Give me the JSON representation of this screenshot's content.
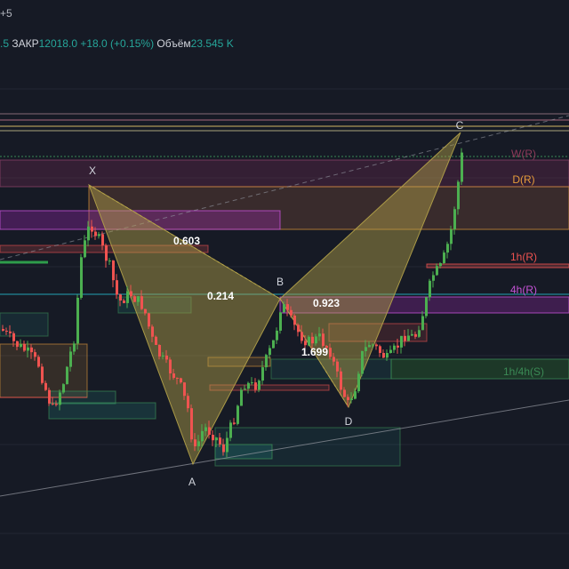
{
  "header": {
    "symbol_fragment": "+5",
    "quote": {
      "prev_fragment": ".5",
      "close_label": "ЗАКР",
      "close_value": "12018.0",
      "change": "+18.0 (+0.15%)",
      "volume_label": "Объём",
      "volume_value": "23.545 K"
    }
  },
  "pattern": {
    "points": [
      {
        "label": "X",
        "color": "#d1d4dc"
      },
      {
        "label": "A",
        "color": "#d1d4dc"
      },
      {
        "label": "B",
        "color": "#d1d4dc"
      },
      {
        "label": "C",
        "color": "#d1d4dc"
      },
      {
        "label": "D",
        "color": "#d1d4dc"
      }
    ],
    "ratios": [
      {
        "value": "0.603",
        "color": "#ffffff"
      },
      {
        "value": "0.214",
        "color": "#ffffff"
      },
      {
        "value": "0.923",
        "color": "#ffffff"
      },
      {
        "value": "1.699",
        "color": "#ffffff"
      }
    ],
    "fill_color": "#b5a349"
  },
  "levels": [
    {
      "label": "W(R)",
      "color": "#8e3a5a"
    },
    {
      "label": "D(R)",
      "color": "#e59b3a"
    },
    {
      "label": "1h(R)",
      "color": "#ef5350"
    },
    {
      "label": "4h(R)",
      "color": "#c653d8"
    },
    {
      "label": "1h/4h(S)",
      "color": "#3b8a55"
    }
  ],
  "colors": {
    "background": "#161a25",
    "candle_up": "#26a69a",
    "candle_up_bright": "#4caf50",
    "candle_down": "#ef5350",
    "grid": "#2a2e39"
  }
}
